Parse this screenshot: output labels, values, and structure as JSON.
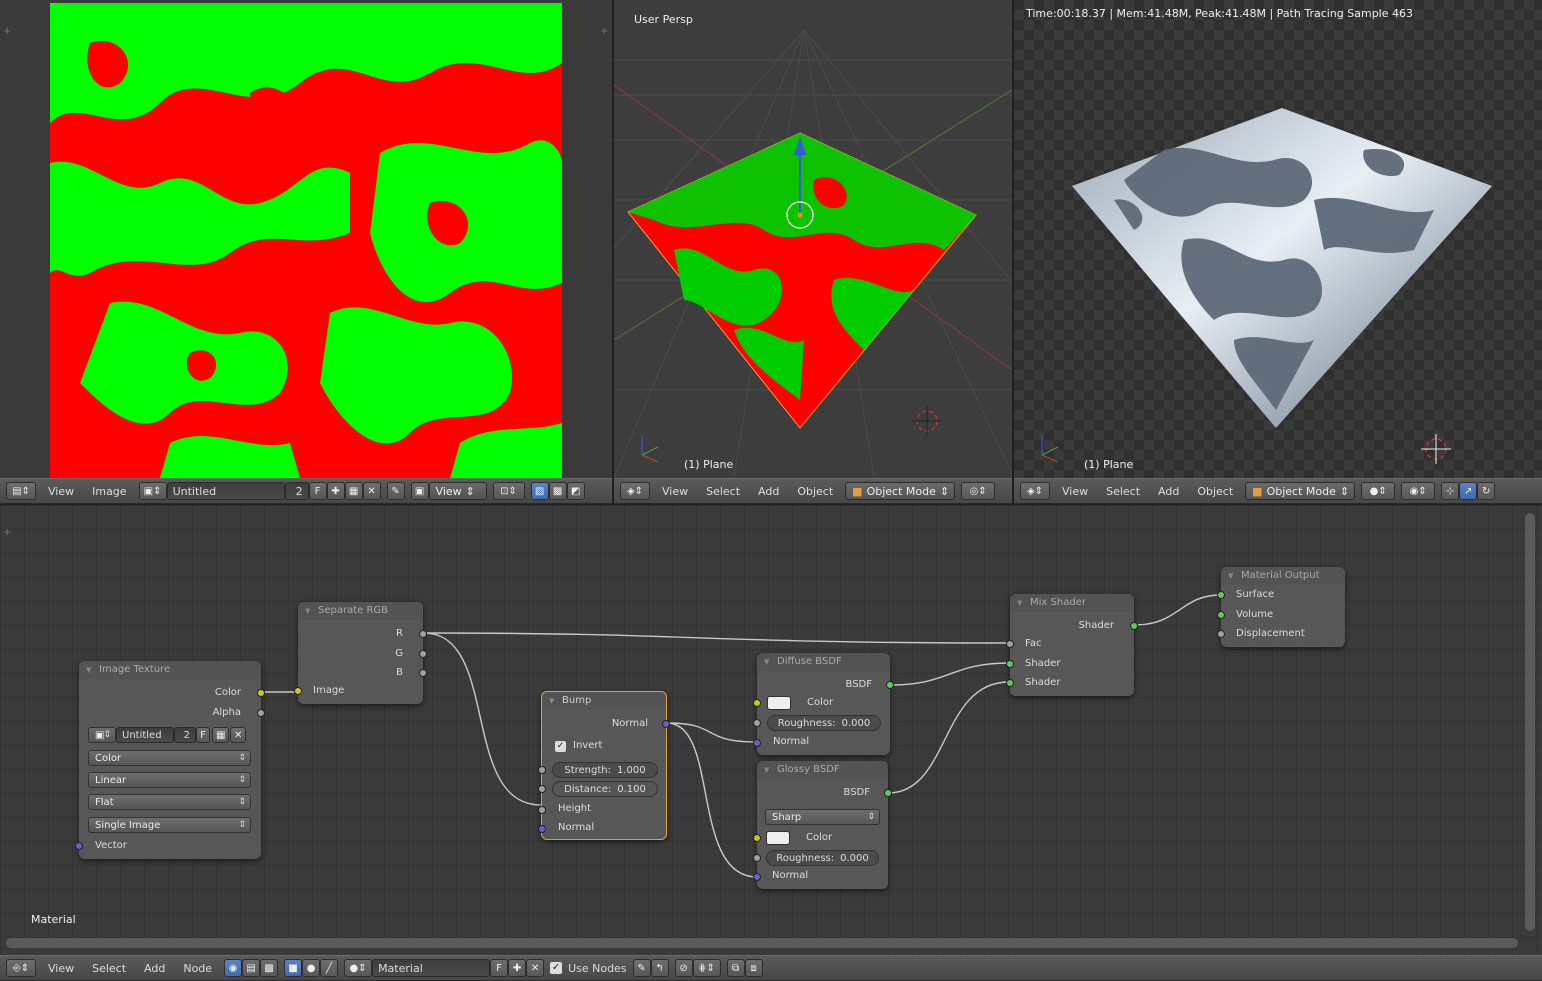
{
  "image_editor": {
    "menus": [
      "View",
      "Image"
    ],
    "image_name": "Untitled",
    "users": "2",
    "fake_user": "F",
    "view_label": "View"
  },
  "viewport_3d": {
    "label": "User Persp",
    "object_label": "(1) Plane",
    "menus": [
      "View",
      "Select",
      "Add",
      "Object"
    ],
    "mode": "Object Mode"
  },
  "render_view": {
    "stats": "Time:00:18.37 | Mem:41.48M, Peak:41.48M | Path Tracing Sample 463",
    "object_label": "(1) Plane",
    "menus": [
      "View",
      "Select",
      "Add",
      "Object"
    ],
    "mode": "Object Mode"
  },
  "node_editor": {
    "material_label": "Material",
    "menus": [
      "View",
      "Select",
      "Add",
      "Node"
    ],
    "material_name": "Material",
    "fake_user": "F",
    "use_nodes": "Use Nodes"
  },
  "nodes": {
    "image_texture": {
      "title": "Image Texture",
      "out_color": "Color",
      "out_alpha": "Alpha",
      "image": "Untitled",
      "users": "2",
      "fake": "F",
      "color_space": "Color",
      "interpolation": "Linear",
      "projection": "Flat",
      "source": "Single Image",
      "in_vector": "Vector"
    },
    "separate_rgb": {
      "title": "Separate RGB",
      "out_r": "R",
      "out_g": "G",
      "out_b": "B",
      "in_image": "Image"
    },
    "bump": {
      "title": "Bump",
      "out_normal": "Normal",
      "invert": "Invert",
      "strength": "Strength:",
      "strength_value": "1.000",
      "distance": "Distance:",
      "distance_value": "0.100",
      "in_height": "Height",
      "in_normal": "Normal"
    },
    "diffuse": {
      "title": "Diffuse BSDF",
      "out_bsdf": "BSDF",
      "in_color": "Color",
      "roughness": "Roughness:",
      "roughness_value": "0.000",
      "in_normal": "Normal"
    },
    "glossy": {
      "title": "Glossy BSDF",
      "out_bsdf": "BSDF",
      "distribution": "Sharp",
      "in_color": "Color",
      "roughness": "Roughness:",
      "roughness_value": "0.000",
      "in_normal": "Normal"
    },
    "mix": {
      "title": "Mix Shader",
      "out_shader": "Shader",
      "in_fac": "Fac",
      "in_shader1": "Shader",
      "in_shader2": "Shader"
    },
    "output": {
      "title": "Material Output",
      "in_surface": "Surface",
      "in_volume": "Volume",
      "in_displacement": "Displacement"
    }
  },
  "colors": {
    "texture_red": "#ff0000",
    "texture_green": "#00ff00",
    "selected_node_border": "#e0a23a",
    "shader_socket": "#63c763",
    "color_socket": "#c7c729",
    "vector_socket": "#6363c7"
  }
}
